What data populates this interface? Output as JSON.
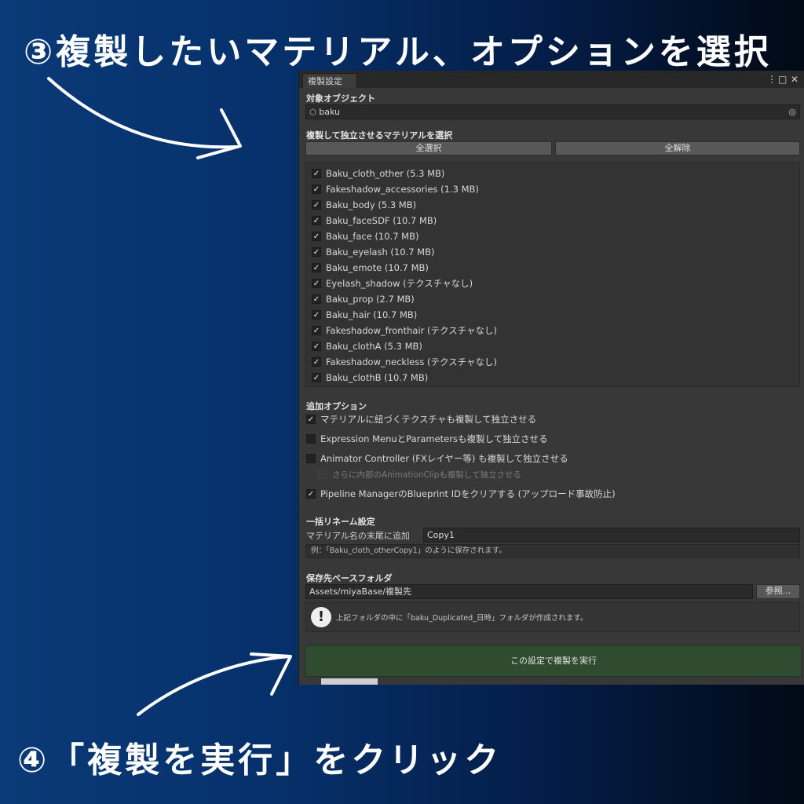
{
  "annotations": {
    "step3": "③複製したいマテリアル、オプションを選択",
    "step4": "④「複製を実行」をクリック"
  },
  "window": {
    "tab_title": "複製設定",
    "controls": {
      "menu": "⋮",
      "maximize": "□",
      "close": "✕"
    }
  },
  "target": {
    "label": "対象オブジェクト",
    "icon": "cube-icon",
    "value": "baku",
    "picker_icon": "object-picker-icon"
  },
  "materials": {
    "label": "複製して独立させるマテリアルを選択",
    "select_all": "全選択",
    "deselect_all": "全解除",
    "items": [
      {
        "label": "Baku_cloth_other (5.3 MB)",
        "checked": true
      },
      {
        "label": "Fakeshadow_accessories (1.3 MB)",
        "checked": true
      },
      {
        "label": "Baku_body (5.3 MB)",
        "checked": true
      },
      {
        "label": "Baku_faceSDF (10.7 MB)",
        "checked": true
      },
      {
        "label": "Baku_face (10.7 MB)",
        "checked": true
      },
      {
        "label": "Baku_eyelash (10.7 MB)",
        "checked": true
      },
      {
        "label": "Baku_emote (10.7 MB)",
        "checked": true
      },
      {
        "label": "Eyelash_shadow (テクスチャなし)",
        "checked": true
      },
      {
        "label": "Baku_prop (2.7 MB)",
        "checked": true
      },
      {
        "label": "Baku_hair (10.7 MB)",
        "checked": true
      },
      {
        "label": "Fakeshadow_fronthair (テクスチャなし)",
        "checked": true
      },
      {
        "label": "Baku_clothA (5.3 MB)",
        "checked": true
      },
      {
        "label": "Fakeshadow_neckless (テクスチャなし)",
        "checked": true
      },
      {
        "label": "Baku_clothB (10.7 MB)",
        "checked": true
      }
    ]
  },
  "options": {
    "label": "追加オプション",
    "items": [
      {
        "label": "マテリアルに紐づくテクスチャも複製して独立させる",
        "checked": true,
        "enabled": true
      },
      {
        "label": "Expression MenuとParametersも複製して独立させる",
        "checked": false,
        "enabled": true
      },
      {
        "label": "Animator Controller (FXレイヤー等) も複製して独立させる",
        "checked": false,
        "enabled": true
      },
      {
        "label": "さらに内部のAnimationClipも複製して独立させる",
        "checked": false,
        "enabled": false
      },
      {
        "label": "Pipeline ManagerのBlueprint IDをクリアする (アップロード事故防止)",
        "checked": true,
        "enabled": true
      }
    ]
  },
  "rename": {
    "label": "一括リネーム設定",
    "suffix_label": "マテリアル名の末尾に追加",
    "suffix_value": "Copy1",
    "example": "例：「Baku_cloth_otherCopy1」のように保存されます。"
  },
  "destination": {
    "label": "保存先ベースフォルダ",
    "path": "Assets/miyaBase/複製先",
    "browse": "参照...",
    "info_icon": "exclamation-icon",
    "info": "上記フォルダの中に「baku_Duplicated_日時」フォルダが作成されます。"
  },
  "execute_label": "この設定で複製を実行"
}
